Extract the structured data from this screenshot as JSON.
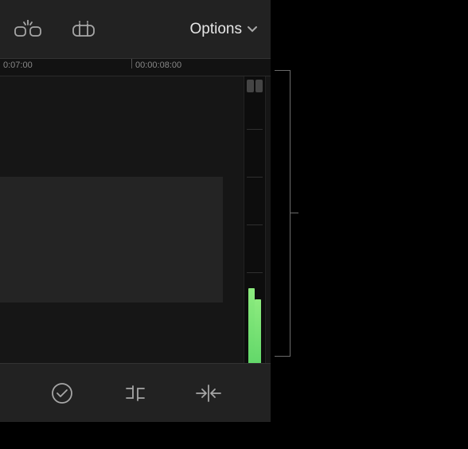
{
  "toolbar": {
    "options_label": "Options"
  },
  "ruler": {
    "ticks": [
      {
        "label": "0:07:00",
        "pos": 4
      },
      {
        "label": "00:00:08:00",
        "pos": 168
      }
    ]
  },
  "audio_meter": {
    "left_channel_pct": 28,
    "right_channel_pct": 24,
    "color": "#7ee27a"
  }
}
